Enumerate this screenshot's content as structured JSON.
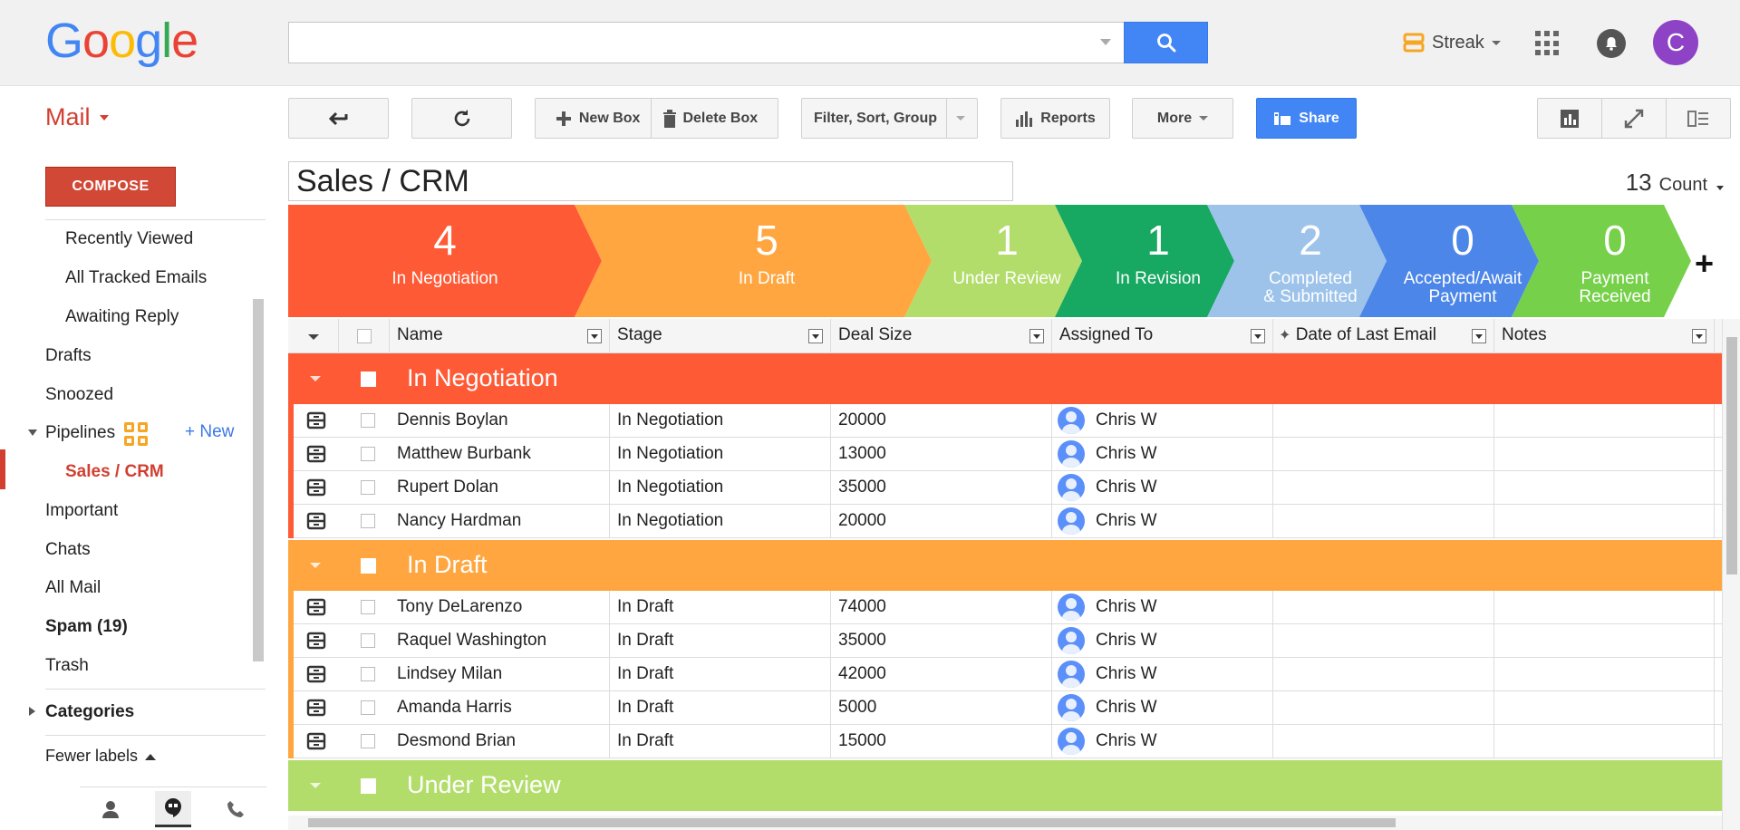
{
  "header": {
    "logo_letters": [
      {
        "ch": "G",
        "color": "#4285f4"
      },
      {
        "ch": "o",
        "color": "#ea4335"
      },
      {
        "ch": "o",
        "color": "#fbbc05"
      },
      {
        "ch": "g",
        "color": "#4285f4"
      },
      {
        "ch": "l",
        "color": "#34a853"
      },
      {
        "ch": "e",
        "color": "#ea4335"
      }
    ],
    "search_value": "",
    "streak_label": "Streak",
    "avatar_letter": "C"
  },
  "sidebar": {
    "mail_label": "Mail",
    "compose_label": "COMPOSE",
    "items": [
      {
        "label": "Recently Viewed"
      },
      {
        "label": "All Tracked Emails"
      },
      {
        "label": "Awaiting Reply"
      },
      {
        "label": "Drafts"
      },
      {
        "label": "Snoozed"
      },
      {
        "label": "Pipelines"
      },
      {
        "label": "Sales / CRM"
      },
      {
        "label": "Important"
      },
      {
        "label": "Chats"
      },
      {
        "label": "All Mail"
      },
      {
        "label": "Spam (19)"
      },
      {
        "label": "Trash"
      },
      {
        "label": "Categories"
      },
      {
        "label": "Fewer labels"
      }
    ],
    "new_pipeline_label": "+ New"
  },
  "toolbar": {
    "new_box_label": "New Box",
    "delete_box_label": "Delete Box",
    "filter_label": "Filter, Sort, Group",
    "reports_label": "Reports",
    "more_label": "More",
    "share_label": "Share"
  },
  "pipeline": {
    "name": "Sales / CRM",
    "count_value": "13",
    "count_label": "Count"
  },
  "stages": [
    {
      "count": "4",
      "label": "In Negotiation",
      "color": "#ff5a36"
    },
    {
      "count": "5",
      "label": "In Draft",
      "color": "#ffa640"
    },
    {
      "count": "1",
      "label": "Under Review",
      "color": "#b2dd6b"
    },
    {
      "count": "1",
      "label": "In Revision",
      "color": "#17a862"
    },
    {
      "count": "2",
      "label": "Completed & Submitted",
      "color": "#9dc3ea"
    },
    {
      "count": "0",
      "label": "Accepted/Await Payment",
      "color": "#4c86e8"
    },
    {
      "count": "0",
      "label": "Payment Received",
      "color": "#76d04a"
    }
  ],
  "columns": [
    "Name",
    "Stage",
    "Deal Size",
    "Assigned To",
    "Date of Last Email",
    "Notes"
  ],
  "groups": [
    {
      "name": "In Negotiation",
      "color": "#ff5a36",
      "rows": [
        {
          "name": "Dennis Boylan",
          "stage": "In Negotiation",
          "deal": "20000",
          "assigned": "Chris W"
        },
        {
          "name": "Matthew Burbank",
          "stage": "In Negotiation",
          "deal": "13000",
          "assigned": "Chris W"
        },
        {
          "name": "Rupert Dolan",
          "stage": "In Negotiation",
          "deal": "35000",
          "assigned": "Chris W"
        },
        {
          "name": "Nancy Hardman",
          "stage": "In Negotiation",
          "deal": "20000",
          "assigned": "Chris W"
        }
      ]
    },
    {
      "name": "In Draft",
      "color": "#ffa640",
      "rows": [
        {
          "name": "Tony DeLarenzo",
          "stage": "In Draft",
          "deal": "74000",
          "assigned": "Chris W"
        },
        {
          "name": "Raquel Washington",
          "stage": "In Draft",
          "deal": "35000",
          "assigned": "Chris W"
        },
        {
          "name": "Lindsey Milan",
          "stage": "In Draft",
          "deal": "42000",
          "assigned": "Chris W"
        },
        {
          "name": "Amanda Harris",
          "stage": "In Draft",
          "deal": "5000",
          "assigned": "Chris W"
        },
        {
          "name": "Desmond Brian",
          "stage": "In Draft",
          "deal": "15000",
          "assigned": "Chris W"
        }
      ]
    },
    {
      "name": "Under Review",
      "color": "#b2dd6b",
      "rows": []
    }
  ]
}
